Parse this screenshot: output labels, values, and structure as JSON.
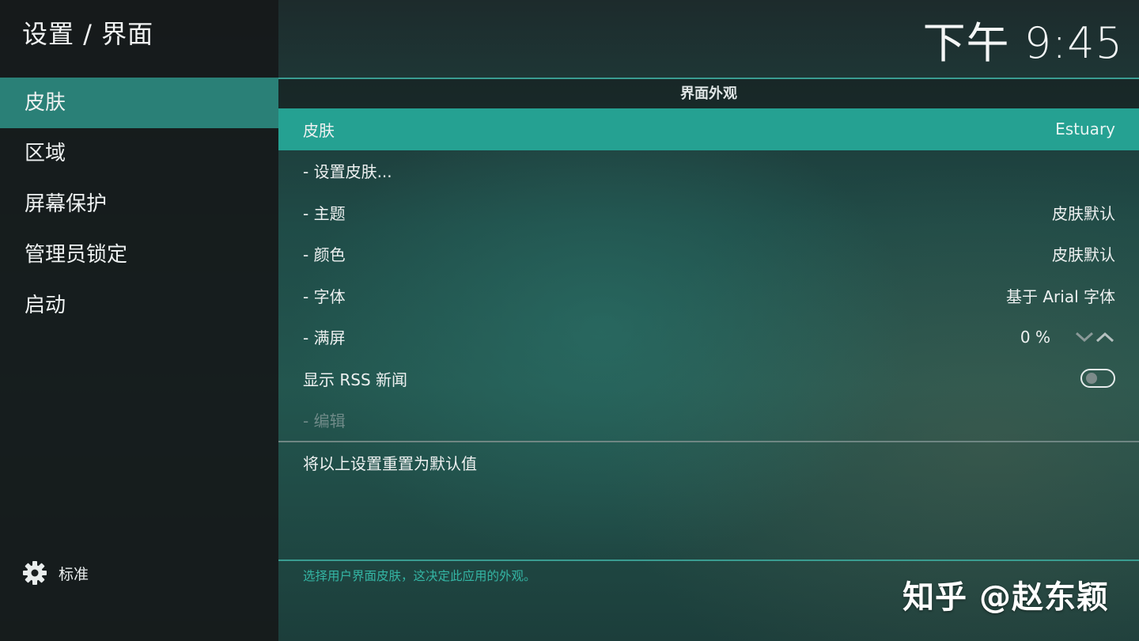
{
  "header": {
    "title": "设置 / 界面",
    "clock": "下午 9:45"
  },
  "sidebar": {
    "items": [
      {
        "label": "皮肤",
        "active": true
      },
      {
        "label": "区域",
        "active": false
      },
      {
        "label": "屏幕保护",
        "active": false
      },
      {
        "label": "管理员锁定",
        "active": false
      },
      {
        "label": "启动",
        "active": false
      }
    ],
    "settings_level": {
      "icon": "gear-icon",
      "label": "标准"
    }
  },
  "main": {
    "section_title": "界面外观",
    "rows": [
      {
        "label": "皮肤",
        "value": "Estuary"
      },
      {
        "label": "- 设置皮肤...",
        "value": ""
      },
      {
        "label": "- 主题",
        "value": "皮肤默认"
      },
      {
        "label": "- 颜色",
        "value": "皮肤默认"
      },
      {
        "label": "- 字体",
        "value": "基于 Arial 字体"
      },
      {
        "label": "- 满屏",
        "value": "0 %",
        "controls": [
          "chevron-down-icon",
          "chevron-up-icon"
        ]
      },
      {
        "label": "显示 RSS 新闻",
        "toggle": false
      },
      {
        "label": "- 编辑",
        "disabled": true
      }
    ],
    "reset_label": "将以上设置重置为默认值",
    "help_text": "选择用户界面皮肤，这决定此应用的外观。"
  },
  "watermark": "知乎 @赵东颖",
  "colors": {
    "accent": "#25a192",
    "sidebar_active": "#2a8077",
    "help_text": "#34b5a4"
  }
}
